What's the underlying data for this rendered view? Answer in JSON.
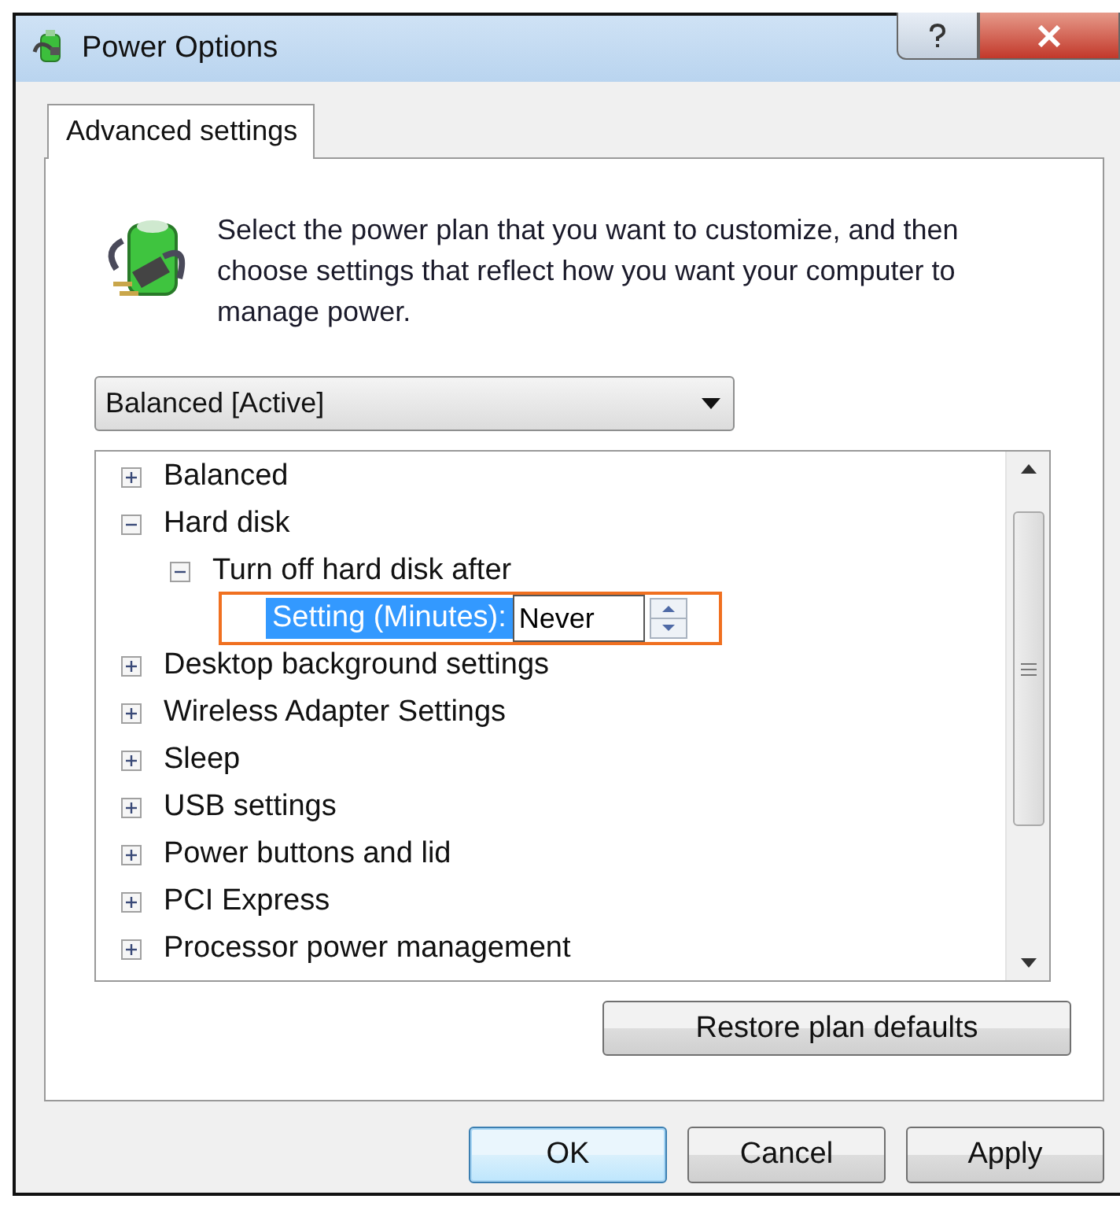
{
  "window": {
    "title": "Power Options"
  },
  "tabs": [
    {
      "label": "Advanced settings",
      "selected": true
    }
  ],
  "description": "Select the power plan that you want to customize, and then choose settings that reflect how you want your computer to manage power.",
  "plan_dropdown": {
    "value": "Balanced [Active]"
  },
  "tree": {
    "items": [
      {
        "label": "Balanced",
        "expanded": false
      },
      {
        "label": "Hard disk",
        "expanded": true,
        "children": [
          {
            "label": "Turn off hard disk after",
            "expanded": true,
            "children": [
              {
                "kind": "setting",
                "label": "Setting (Minutes):",
                "value": "Never",
                "selected": true,
                "highlighted": true
              }
            ]
          }
        ]
      },
      {
        "label": "Desktop background settings",
        "expanded": false
      },
      {
        "label": "Wireless Adapter Settings",
        "expanded": false
      },
      {
        "label": "Sleep",
        "expanded": false
      },
      {
        "label": "USB settings",
        "expanded": false
      },
      {
        "label": "Power buttons and lid",
        "expanded": false
      },
      {
        "label": "PCI Express",
        "expanded": false
      },
      {
        "label": "Processor power management",
        "expanded": false
      }
    ]
  },
  "restore_button": "Restore plan defaults",
  "buttons": [
    "OK",
    "Cancel",
    "Apply"
  ]
}
